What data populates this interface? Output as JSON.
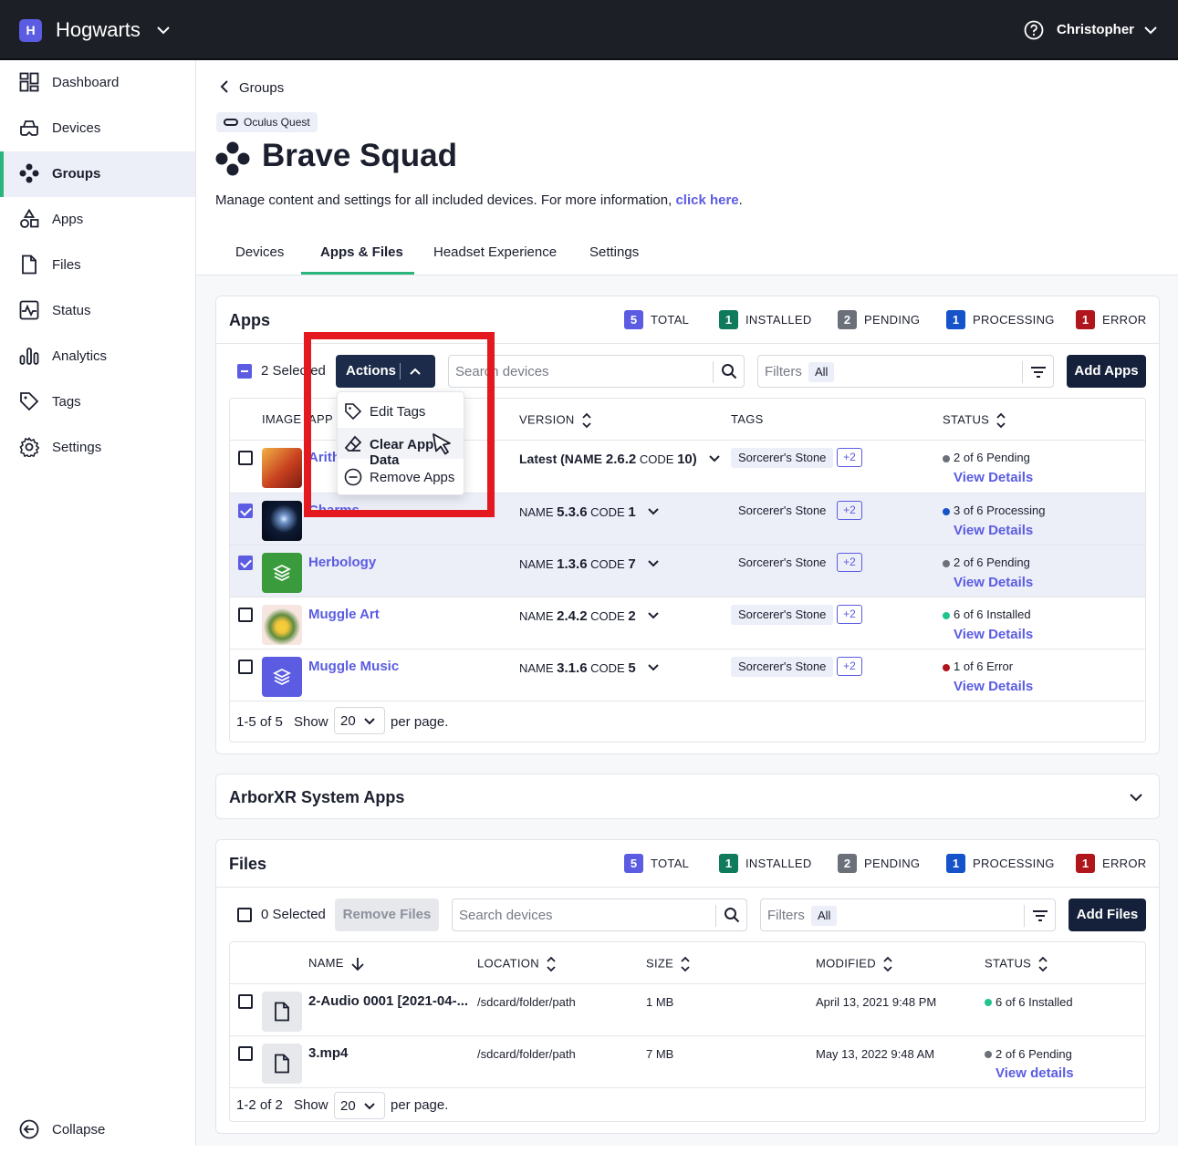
{
  "topbar": {
    "org_initial": "H",
    "org_name": "Hogwarts",
    "user_name": "Christopher"
  },
  "sidebar": {
    "items": [
      {
        "label": "Dashboard",
        "icon": "dashboard-icon"
      },
      {
        "label": "Devices",
        "icon": "headset-icon"
      },
      {
        "label": "Groups",
        "icon": "groups-icon",
        "active": true
      },
      {
        "label": "Apps",
        "icon": "apps-icon"
      },
      {
        "label": "Files",
        "icon": "file-icon"
      },
      {
        "label": "Status",
        "icon": "status-icon"
      },
      {
        "label": "Analytics",
        "icon": "analytics-icon"
      },
      {
        "label": "Tags",
        "icon": "tag-icon"
      },
      {
        "label": "Settings",
        "icon": "gear-icon"
      }
    ],
    "collapse_label": "Collapse"
  },
  "header": {
    "back_label": "Groups",
    "platform": "Oculus Quest",
    "title": "Brave Squad",
    "description": "Manage content and settings for all included devices. For more information, ",
    "link_text": "click here",
    "link_suffix": ".",
    "tabs": [
      "Devices",
      "Apps & Files",
      "Headset Experience",
      "Settings"
    ],
    "active_tab": "Apps & Files"
  },
  "colors": {
    "accent": "#5b5ce2",
    "installed": "#0f7b5c",
    "pending": "#6b7079",
    "processing": "#1652c9",
    "error": "#b0151b"
  },
  "apps": {
    "title": "Apps",
    "stats": [
      {
        "num": "5",
        "label": "TOTAL",
        "color": "#5b5ce2"
      },
      {
        "num": "1",
        "label": "INSTALLED",
        "color": "#0f7b5c"
      },
      {
        "num": "2",
        "label": "PENDING",
        "color": "#6b7079"
      },
      {
        "num": "1",
        "label": "PROCESSING",
        "color": "#1652c9"
      },
      {
        "num": "1",
        "label": "ERROR",
        "color": "#b0151b"
      }
    ],
    "selected": "2 Selected",
    "actions_label": "Actions",
    "search_placeholder": "Search devices",
    "filters_label": "Filters",
    "filters_value": "All",
    "add_label": "Add Apps",
    "columns": [
      "IMAGE",
      "APP NAME",
      "VERSION",
      "TAGS",
      "STATUS"
    ],
    "rows": [
      {
        "name": "Arithmancy",
        "version_prefix": "Latest (NAME ",
        "version_name": "2.6.2",
        "code_label": " CODE ",
        "code": "10",
        "version_suffix": ")",
        "tag": "Sorcerer's Stone",
        "more": "+2",
        "status": "2 of 6 Pending",
        "status_color": "#6b7079",
        "details": "View Details",
        "checked": false
      },
      {
        "name": "Charms",
        "version_prefix": "NAME ",
        "version_name": "5.3.6",
        "code_label": " CODE ",
        "code": "1",
        "version_suffix": "",
        "tag": "Sorcerer's Stone",
        "more": "+2",
        "status": "3 of 6 Processing",
        "status_color": "#1652c9",
        "details": "View Details",
        "checked": true
      },
      {
        "name": "Herbology",
        "version_prefix": "NAME ",
        "version_name": "1.3.6",
        "code_label": " CODE ",
        "code": "7",
        "version_suffix": "",
        "tag": "Sorcerer's Stone",
        "more": "+2",
        "status": "2 of 6 Pending",
        "status_color": "#6b7079",
        "details": "View Details",
        "checked": true
      },
      {
        "name": "Muggle Art",
        "version_prefix": "NAME ",
        "version_name": "2.4.2",
        "code_label": " CODE ",
        "code": "2",
        "version_suffix": "",
        "tag": "Sorcerer's Stone",
        "more": "+2",
        "status": "6 of 6 Installed",
        "status_color": "#21c48c",
        "details": "View Details",
        "checked": false
      },
      {
        "name": "Muggle Music",
        "version_prefix": "NAME ",
        "version_name": "3.1.6",
        "code_label": " CODE ",
        "code": "5",
        "version_suffix": "",
        "tag": "Sorcerer's Stone",
        "more": "+2",
        "status": "1 of 6 Error",
        "status_color": "#b0151b",
        "details": "View Details",
        "checked": false
      }
    ],
    "pager": {
      "range": "1-5 of 5",
      "show": "Show",
      "per_page_value": "20",
      "per_page_label": "per page."
    },
    "actions_menu": [
      "Edit Tags",
      "Clear App Data",
      "Remove Apps"
    ]
  },
  "system_apps": {
    "title": "ArborXR System Apps"
  },
  "files": {
    "title": "Files",
    "stats": [
      {
        "num": "5",
        "label": "TOTAL",
        "color": "#5b5ce2"
      },
      {
        "num": "1",
        "label": "INSTALLED",
        "color": "#0f7b5c"
      },
      {
        "num": "2",
        "label": "PENDING",
        "color": "#6b7079"
      },
      {
        "num": "1",
        "label": "PROCESSING",
        "color": "#1652c9"
      },
      {
        "num": "1",
        "label": "ERROR",
        "color": "#b0151b"
      }
    ],
    "selected": "0 Selected",
    "remove_label": "Remove Files",
    "search_placeholder": "Search devices",
    "filters_label": "Filters",
    "filters_value": "All",
    "add_label": "Add Files",
    "columns": [
      "NAME",
      "LOCATION",
      "SIZE",
      "MODIFIED",
      "STATUS"
    ],
    "rows": [
      {
        "name": "2-Audio 0001 [2021-04-...",
        "location": "/sdcard/folder/path",
        "size": "1 MB",
        "modified": "April 13, 2021 9:48 PM",
        "status": "6 of 6 Installed",
        "status_color": "#21c48c",
        "details": ""
      },
      {
        "name": "3.mp4",
        "location": "/sdcard/folder/path",
        "size": "7 MB",
        "modified": "May 13, 2022 9:48 AM",
        "status": "2 of 6 Pending",
        "status_color": "#6b7079",
        "details": "View details"
      }
    ],
    "pager": {
      "range": "1-2 of 2",
      "show": "Show",
      "per_page_value": "20",
      "per_page_label": "per page."
    }
  }
}
